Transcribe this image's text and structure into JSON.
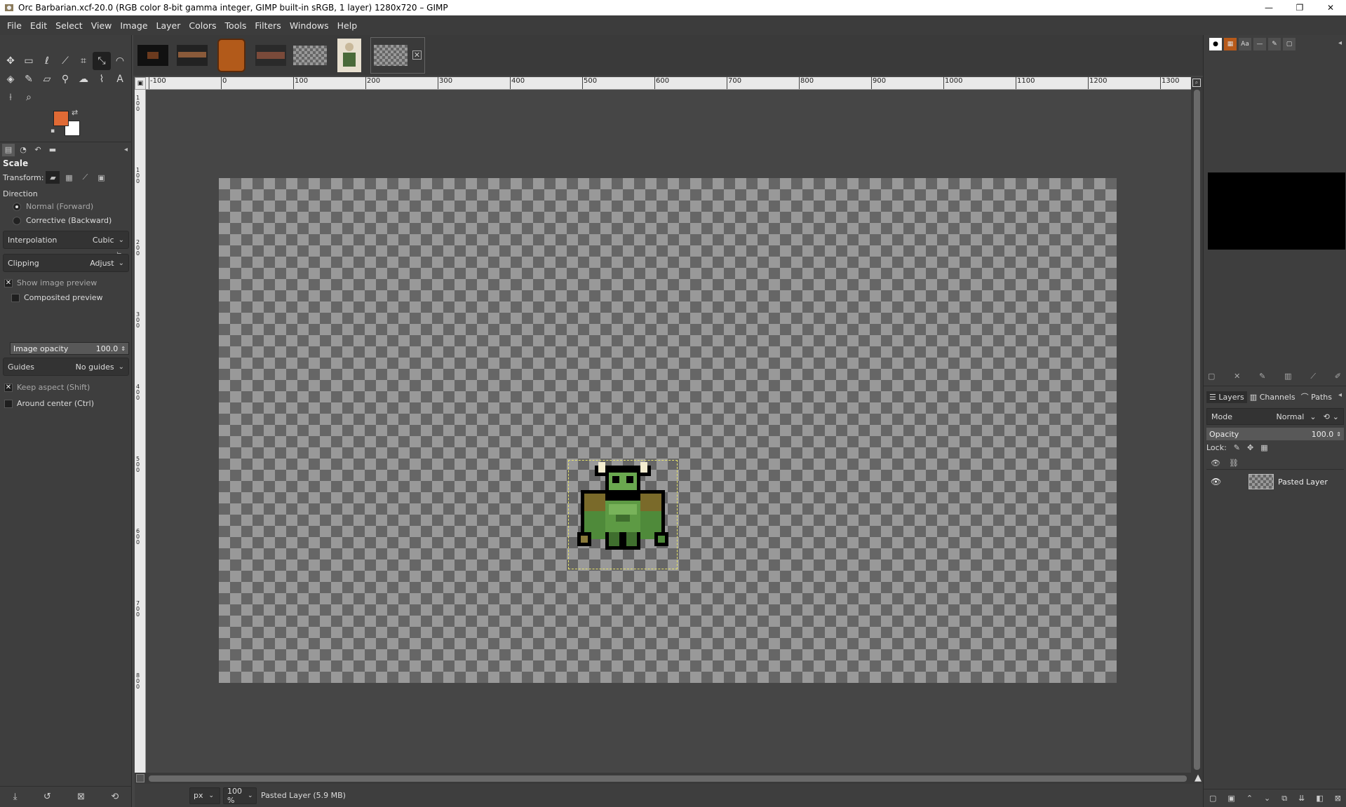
{
  "window": {
    "title": "Orc Barbarian.xcf-20.0 (RGB color 8-bit gamma integer, GIMP built-in sRGB, 1 layer) 1280x720 – GIMP",
    "minimize": "—",
    "maximize": "❐",
    "close": "✕"
  },
  "menu": [
    "File",
    "Edit",
    "Select",
    "View",
    "Image",
    "Layer",
    "Colors",
    "Tools",
    "Filters",
    "Windows",
    "Help"
  ],
  "colors": {
    "foreground": "#e06a35",
    "background": "#ffffff",
    "selection_marching_ants": "#e7e36a"
  },
  "tool_options": {
    "title": "Scale",
    "transform_label": "Transform:",
    "direction_label": "Direction",
    "direction_options": [
      "Normal (Forward)",
      "Corrective (Backward)"
    ],
    "direction_selected": "Normal (Forward)",
    "interpolation_label": "Interpolation",
    "interpolation_value": "Cubic",
    "clipping_label": "Clipping",
    "clipping_value": "Adjust",
    "show_image_preview": "Show image preview",
    "show_image_preview_checked": true,
    "composited_preview": "Composited preview",
    "composited_preview_checked": false,
    "image_opacity_label": "Image opacity",
    "image_opacity_value": "100.0",
    "guides_label": "Guides",
    "guides_value": "No guides",
    "keep_aspect": "Keep aspect (Shift)",
    "keep_aspect_checked": true,
    "around_center": "Around center (Ctrl)",
    "around_center_checked": false
  },
  "ruler": {
    "corner": "▣",
    "top_labels": [
      "-100",
      "0",
      "100",
      "200",
      "300",
      "400",
      "500",
      "600",
      "700",
      "800",
      "900",
      "1000",
      "1100",
      "1200",
      "1300"
    ],
    "left_labels": [
      "1",
      "0",
      "0",
      "1",
      "0",
      "0",
      "2",
      "0",
      "0",
      "3",
      "0",
      "0",
      "4",
      "0",
      "0",
      "5",
      "0",
      "0",
      "6",
      "0",
      "0",
      "7",
      "0",
      "0",
      "8",
      "0",
      "0"
    ]
  },
  "statusbar": {
    "unit": "px",
    "zoom": "100 %",
    "message": "Pasted Layer (5.9 MB)"
  },
  "layers_panel": {
    "tabs": [
      "Layers",
      "Channels",
      "Paths"
    ],
    "mode_label": "Mode",
    "mode_value": "Normal",
    "opacity_label": "Opacity",
    "opacity_value": "100.0",
    "lock_label": "Lock:",
    "layers": [
      {
        "name": "Pasted Layer",
        "visible": true
      }
    ]
  },
  "dock_tabs": [
    "●",
    "▦",
    "Aa",
    "—",
    "✎",
    "▢"
  ]
}
